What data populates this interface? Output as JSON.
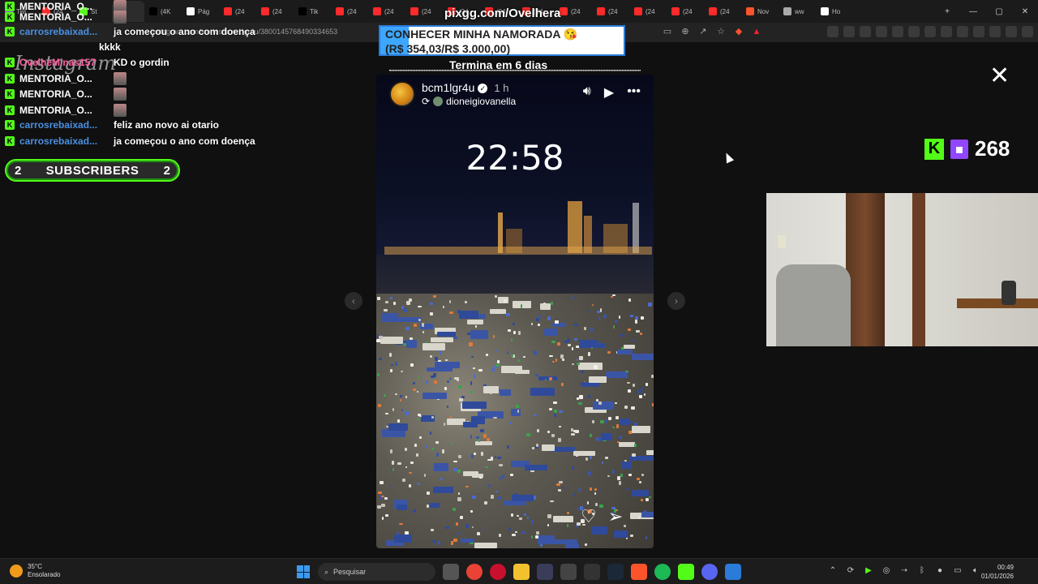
{
  "browser": {
    "tabs": [
      {
        "label": "Twi",
        "color": "#9146ff"
      },
      {
        "label": "(24",
        "color": "#ff2a2a"
      },
      {
        "label": "St",
        "color": "#53fc18"
      },
      {
        "label": "",
        "color": "#e1306c"
      },
      {
        "label": "(4K",
        "color": "#000000"
      },
      {
        "label": "Pág",
        "color": "#ffffff"
      },
      {
        "label": "(24",
        "color": "#ff2a2a"
      },
      {
        "label": "(24",
        "color": "#ff2a2a"
      },
      {
        "label": "Tik",
        "color": "#000000"
      },
      {
        "label": "(24",
        "color": "#ff2a2a"
      },
      {
        "label": "(24",
        "color": "#ff2a2a"
      },
      {
        "label": "(24",
        "color": "#ff2a2a"
      },
      {
        "label": "(24",
        "color": "#ff2a2a"
      },
      {
        "label": "(24",
        "color": "#ff2a2a"
      },
      {
        "label": "(24",
        "color": "#ff2a2a"
      },
      {
        "label": "(24",
        "color": "#ff2a2a"
      },
      {
        "label": "(24",
        "color": "#ff2a2a"
      },
      {
        "label": "(24",
        "color": "#ff2a2a"
      },
      {
        "label": "(24",
        "color": "#ff2a2a"
      },
      {
        "label": "(24",
        "color": "#ff2a2a"
      },
      {
        "label": "Nov",
        "color": "#fb542b"
      },
      {
        "label": "ww",
        "color": "#aaaaaa"
      },
      {
        "label": "Ho",
        "color": "#ffffff"
      }
    ],
    "url": "instagram.com/stories/bcm1lgr4u/3800145768490334653"
  },
  "chat": [
    {
      "user": "MENTORIA_O...",
      "msg": "",
      "avatar": true,
      "color": "white"
    },
    {
      "user": "MENTORIA_O...",
      "msg": "",
      "avatar": true,
      "color": "white"
    },
    {
      "user": "carrosrebaixad...",
      "msg": "ja começou o ano com doença",
      "avatar": false,
      "color": "blue"
    },
    {
      "user": "",
      "msg": "kkkk",
      "avatar": false,
      "color": "white"
    },
    {
      "user": "OvelheMinas157",
      "msg": "KD o gordin",
      "avatar": false,
      "color": "pink"
    },
    {
      "user": "MENTORIA_O...",
      "msg": "",
      "avatar": true,
      "color": "white"
    },
    {
      "user": "MENTORIA_O...",
      "msg": "",
      "avatar": true,
      "color": "white"
    },
    {
      "user": "MENTORIA_O...",
      "msg": "",
      "avatar": true,
      "color": "white"
    },
    {
      "user": "carrosrebaixad...",
      "msg": "feliz ano novo ai otario",
      "avatar": false,
      "color": "blue"
    },
    {
      "user": "carrosrebaixad...",
      "msg": "ja começou o ano com doença",
      "avatar": false,
      "color": "blue"
    }
  ],
  "subs": {
    "left": "2",
    "label": "SUBSCRIBERS",
    "right": "2"
  },
  "watermark": "Instagram",
  "pix": {
    "title": "pixgg.com/Ovelhera",
    "goal_line1": "CONHECER MINHA NAMORADA 😘",
    "goal_line2": "(R$ 354,03/R$ 3.000,00)",
    "progress": 0.118,
    "timer": "Termina em 6 dias"
  },
  "story": {
    "username": "bcm1lgr4u",
    "age": "1 h",
    "reposted_from": "dioneigiovanella",
    "time_overlay": "22:58",
    "mute_icon": "volume-icon",
    "play_icon": "play-icon",
    "more_icon": "more-icon",
    "like_icon": "heart-icon",
    "share_icon": "send-icon"
  },
  "close_label": "✕",
  "viewers": {
    "count": "268"
  },
  "taskbar": {
    "weather_temp": "35°C",
    "weather_desc": "Ensolarado",
    "search_placeholder": "Pesquisar",
    "time": "00:49",
    "date": "01/01/2026"
  },
  "colors": {
    "kick_green": "#53fc18",
    "twitch_purple": "#9146ff",
    "pix_blue": "#3da7ff"
  }
}
